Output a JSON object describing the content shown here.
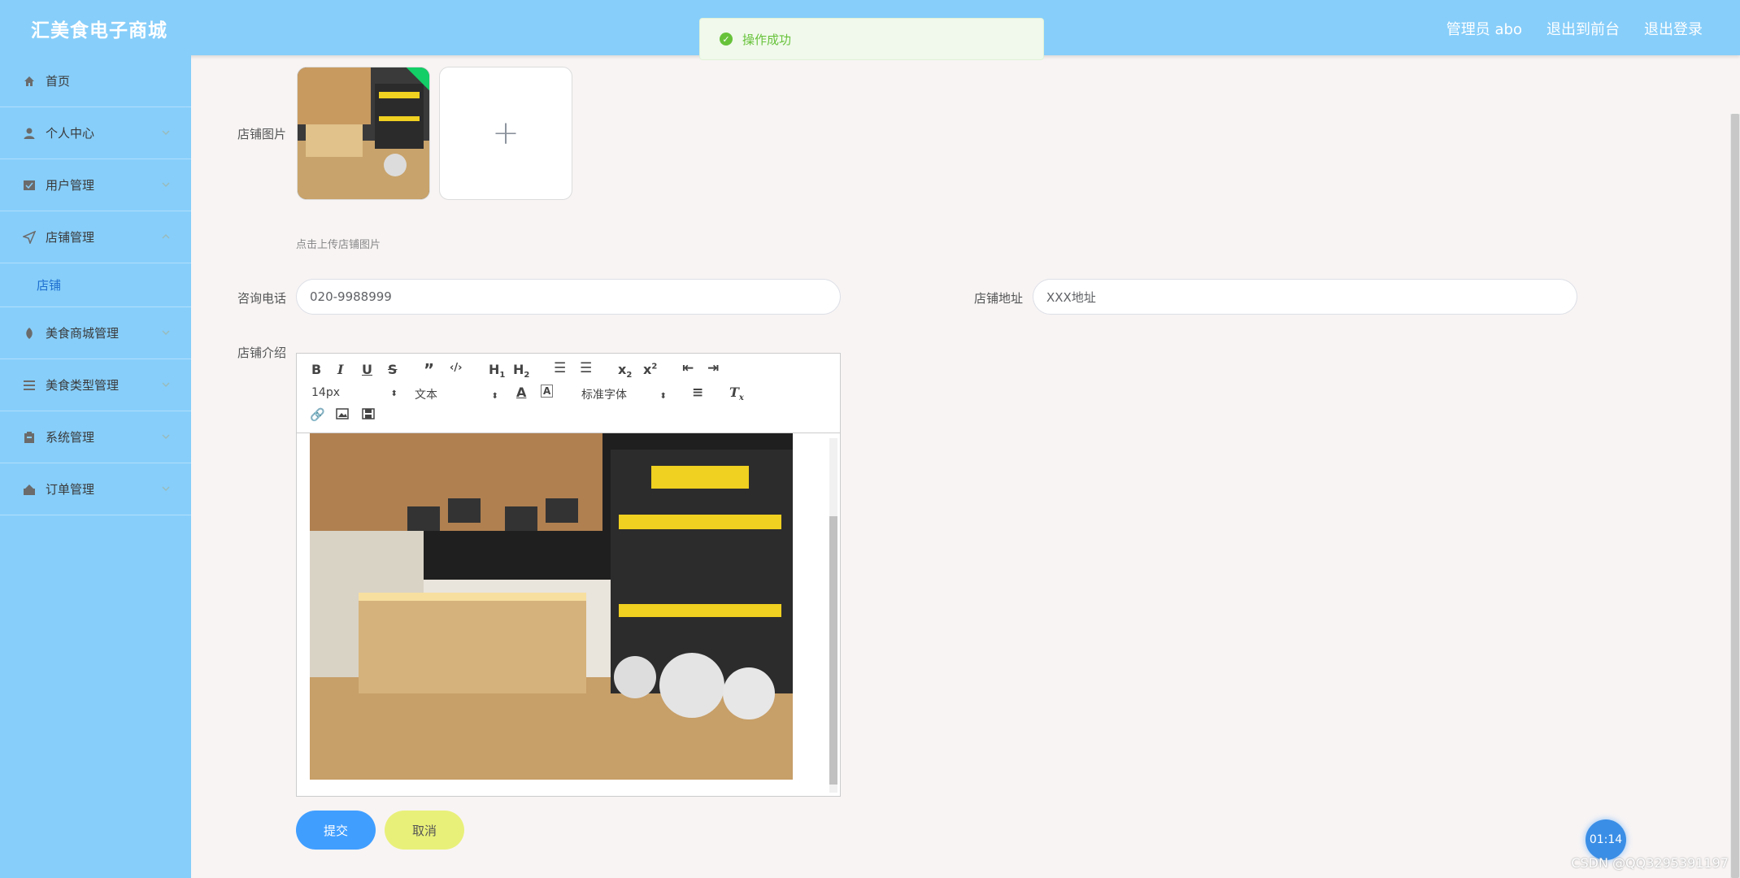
{
  "header": {
    "brand": "汇美食电子商城",
    "admin": "管理员 abo",
    "to_frontend": "退出到前台",
    "logout": "退出登录"
  },
  "toast": {
    "message": "操作成功"
  },
  "sidebar": {
    "items": [
      {
        "label": "首页",
        "icon": "home-icon"
      },
      {
        "label": "个人中心",
        "icon": "user-icon"
      },
      {
        "label": "用户管理",
        "icon": "users-icon"
      },
      {
        "label": "店铺管理",
        "icon": "send-icon",
        "expanded": true
      },
      {
        "label": "美食商城管理",
        "icon": "food-icon"
      },
      {
        "label": "美食类型管理",
        "icon": "list-icon"
      },
      {
        "label": "系统管理",
        "icon": "system-icon"
      },
      {
        "label": "订单管理",
        "icon": "order-icon"
      }
    ],
    "sub_item": "店铺"
  },
  "form": {
    "shop_image_label": "店铺图片",
    "upload_hint": "点击上传店铺图片",
    "phone_label": "咨询电话",
    "phone_value": "020-9988999",
    "address_label": "店铺地址",
    "address_value": "XXX地址",
    "intro_label": "店铺介绍"
  },
  "editor": {
    "font_size": "14px",
    "block_type": "文本",
    "font_family": "标准字体",
    "tools": [
      "bold-icon",
      "italic-icon",
      "underline-icon",
      "strike-icon",
      "quote-icon",
      "code-icon",
      "h1-icon",
      "h2-icon",
      "ordered-list-icon",
      "bullet-list-icon",
      "subscript-icon",
      "superscript-icon",
      "outdent-icon",
      "indent-icon",
      "font-color-icon",
      "background-color-icon",
      "align-icon",
      "clear-format-icon",
      "link-icon",
      "image-icon",
      "video-icon"
    ]
  },
  "buttons": {
    "submit": "提交",
    "cancel": "取消"
  },
  "timer": "01:14",
  "watermark": "CSDN @QQ3295391197"
}
